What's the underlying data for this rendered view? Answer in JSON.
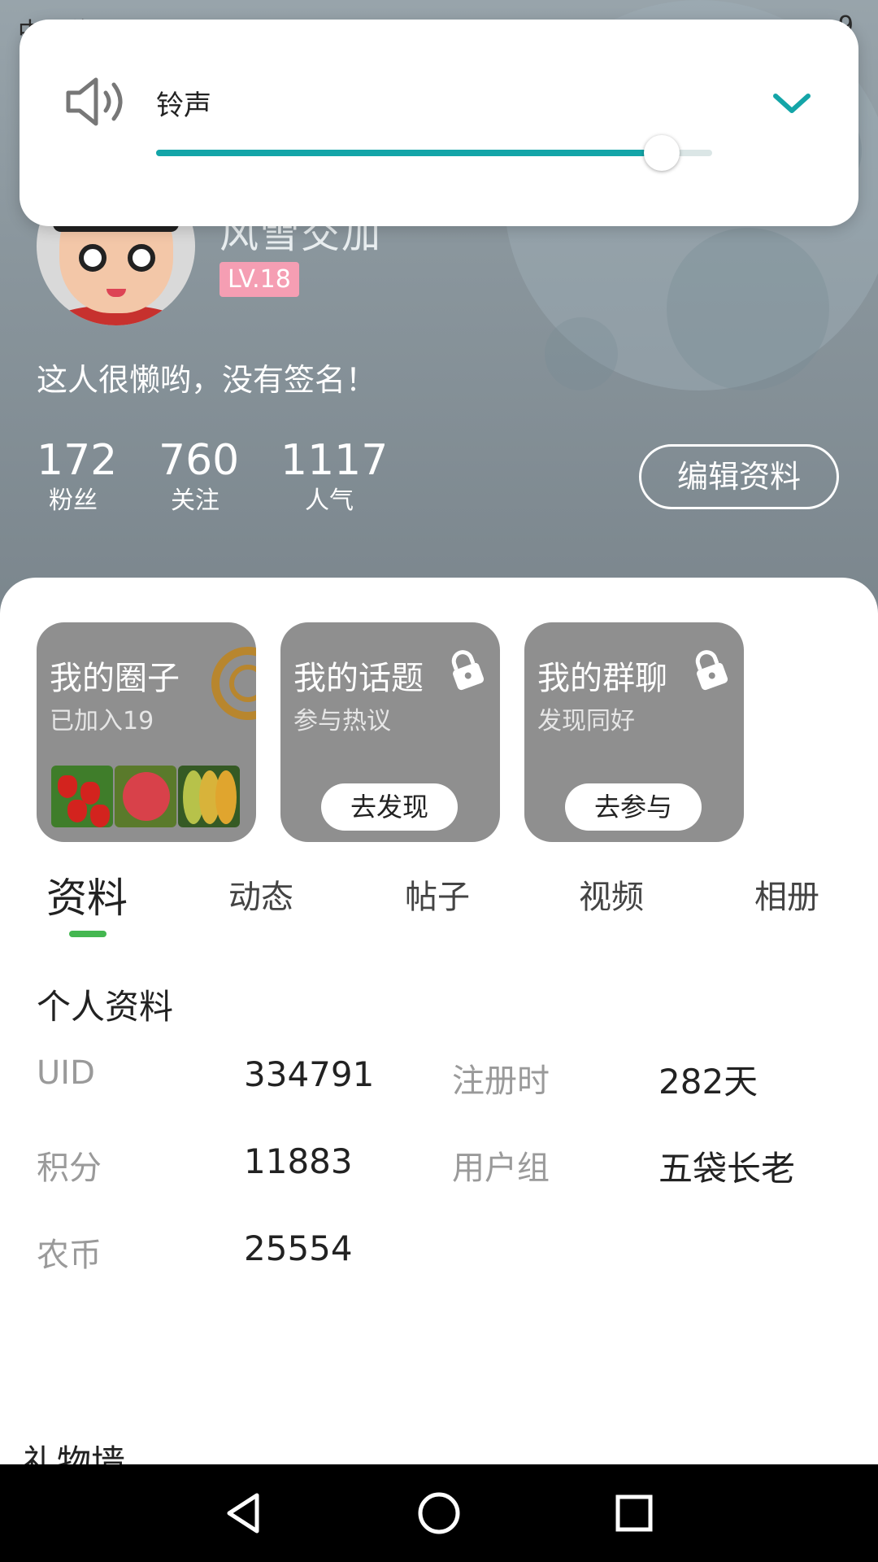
{
  "status_bar": {
    "left_text": "中国移动",
    "right_text": "9"
  },
  "volume_panel": {
    "label": "铃声",
    "level": 0.91,
    "accent_color": "#14a5a8",
    "icons": {
      "speaker": "speaker-icon",
      "expand": "chevron-down-icon"
    }
  },
  "profile": {
    "nickname": "风雪交加",
    "level": "LV.18",
    "signature": "这人很懒哟，没有签名！",
    "stats": [
      {
        "value": "172",
        "label": "粉丝"
      },
      {
        "value": "760",
        "label": "关注"
      },
      {
        "value": "1117",
        "label": "人气"
      }
    ],
    "edit_button": "编辑资料"
  },
  "cards": [
    {
      "title": "我的圈子",
      "subtitle": "已加入19"
    },
    {
      "title": "我的话题",
      "subtitle": "参与热议",
      "button": "去发现",
      "icon": "lock-icon"
    },
    {
      "title": "我的群聊",
      "subtitle": "发现同好",
      "button": "去参与",
      "icon": "lock-icon"
    }
  ],
  "tabs": [
    "资料",
    "动态",
    "帖子",
    "视频",
    "相册"
  ],
  "active_tab": "资料",
  "details": {
    "section_title": "个人资料",
    "rows": [
      {
        "k1": "UID",
        "v1": "334791",
        "k2": "注册时",
        "v2": "282天"
      },
      {
        "k1": "积分",
        "v1": "11883",
        "k2": "用户组",
        "v2": "五袋长老"
      },
      {
        "k1": "农币",
        "v1": "25554"
      }
    ]
  },
  "gift_wall_title": "礼物墙",
  "nav": {
    "back": "back-icon",
    "home": "home-icon",
    "recents": "recents-icon"
  }
}
